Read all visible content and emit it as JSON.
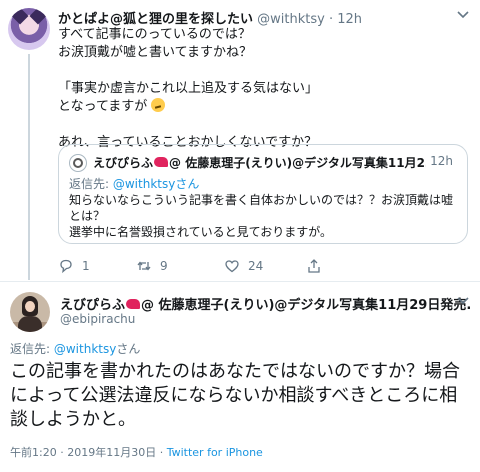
{
  "reply_tweet": {
    "display_name": "かとぱよ@狐と狸の里を探したい",
    "handle": "@withktsy",
    "separator": "·",
    "time": "12h",
    "lines": [
      "すべて記事にのっているのでは？",
      "お涙頂戴が嘘と書いてますかね？",
      "",
      "「事実か虚言かこれ以上追及する気はない」",
      "となってますが",
      "",
      "あれ、言っていることおかしくないですか？"
    ],
    "quoted": {
      "display_name": "えびぴらふ",
      "name_rest": "@ 佐藤恵理子(えりい)@デジタル写真集11月2…",
      "time": "12h",
      "replying_to_label": "返信先: ",
      "replying_to_handle": "@withktsyさん",
      "body_lines": [
        "知らないならこういう記事を書く自体おかしいのでは？？お涙頂戴は嘘",
        "とは？",
        "選挙中に名誉毀損されていると見ておりますが。"
      ]
    },
    "actions": {
      "reply_count": "1",
      "retweet_count": "9",
      "like_count": "24"
    }
  },
  "main_tweet": {
    "display_name": "えびぴらふ",
    "name_rest": "@ 佐藤恵理子(えりい)@デジタル写真集11月29日発売...",
    "handle": "@ebipirachu",
    "replying_to_label": "返信先: ",
    "replying_to_handle": "@withktsy",
    "replying_to_suffix": "さん",
    "body": "この記事を書かれたのはあなたではないのですか？場合によって公選法違反にならないか相談すべきところに相談しようかと。",
    "time": "午前1:20",
    "dot": "·",
    "date": "2019年11月30日",
    "dot2": "·",
    "source": "Twitter for iPhone"
  },
  "colors": {
    "link": "#1b95e0",
    "secondary_text": "#657786",
    "border": "#ccd6dd"
  },
  "icons": [
    "chevron-down-icon",
    "reply-icon",
    "retweet-icon",
    "like-icon",
    "share-icon",
    "thinking-face-icon",
    "shrimp-icon"
  ]
}
